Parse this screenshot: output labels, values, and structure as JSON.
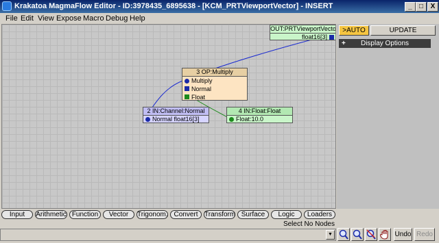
{
  "window": {
    "title": "Krakatoa MagmaFlow Editor - ID:3978435_6895638 - [KCM_PRTViewportVector] - INSERT",
    "min_glyph": "_",
    "max_glyph": "□",
    "close_glyph": "X"
  },
  "menu": [
    "File",
    "Edit",
    "View",
    "Expose",
    "Macro",
    "Debug",
    "Help"
  ],
  "nodes": {
    "output": {
      "title": "OUT:PRTViewportVecto",
      "port": "float16[3]"
    },
    "multiply": {
      "title": "3 OP:Multiply",
      "ports": [
        "Multiply",
        "Normal",
        "Float"
      ]
    },
    "normal": {
      "title": "2 IN:Channel:Normal",
      "port": "Normal float16[3]"
    },
    "float": {
      "title": "4 IN:Float:Float",
      "port": "Float:10.0"
    }
  },
  "side": {
    "auto_label": ">AUTO",
    "update_label": "UPDATE",
    "rollout_plus": "+",
    "rollout_label": "Display Options"
  },
  "categories": [
    "Input",
    "Arithmetic",
    "Function",
    "Vector",
    "Trigonom.",
    "Convert",
    "Transform",
    "Surface",
    "Logic",
    "Loaders"
  ],
  "status": "Select No Nodes",
  "buttons": {
    "undo": "Undo",
    "redo": "Redo"
  },
  "dropdown_arrow": "▼",
  "icons": [
    "zoom-in-icon",
    "zoom-out-icon",
    "zoom-reset-icon",
    "pan-hand-icon"
  ]
}
